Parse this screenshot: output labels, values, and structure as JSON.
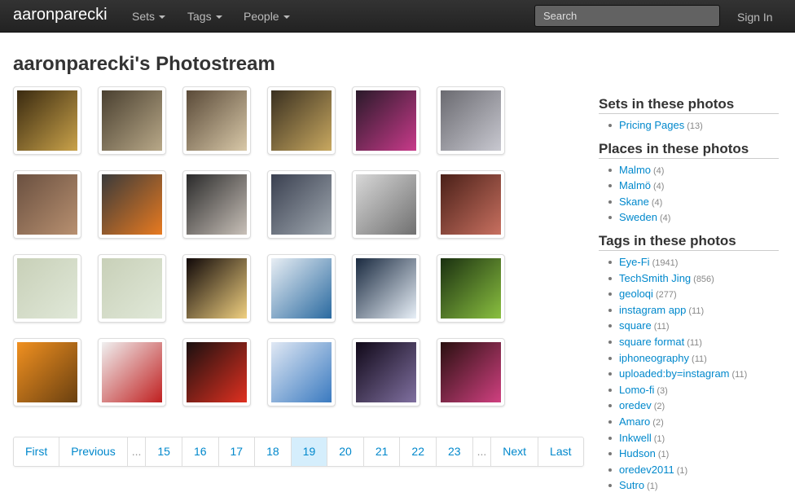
{
  "navbar": {
    "brand": "aaronparecki",
    "items": [
      {
        "label": "Sets"
      },
      {
        "label": "Tags"
      },
      {
        "label": "People"
      }
    ],
    "search_placeholder": "Search",
    "signin": "Sign In"
  },
  "page_title": "aaronparecki's Photostream",
  "thumbnails": [
    {
      "subject": "chandelier"
    },
    {
      "subject": "dining hall"
    },
    {
      "subject": "banquet table"
    },
    {
      "subject": "ballroom crowd"
    },
    {
      "subject": "pink menu"
    },
    {
      "subject": "street"
    },
    {
      "subject": "person in hallway"
    },
    {
      "subject": "orange sign"
    },
    {
      "subject": "notebook"
    },
    {
      "subject": "laptop"
    },
    {
      "subject": "comic sketch"
    },
    {
      "subject": "person at table"
    },
    {
      "subject": "map"
    },
    {
      "subject": "map"
    },
    {
      "subject": "stage lights"
    },
    {
      "subject": "pricing page"
    },
    {
      "subject": "pricing page"
    },
    {
      "subject": "green stage"
    },
    {
      "subject": "orange document"
    },
    {
      "subject": "newspaper page"
    },
    {
      "subject": "red card"
    },
    {
      "subject": "pricing page"
    },
    {
      "subject": "dark room"
    },
    {
      "subject": "pink menu"
    }
  ],
  "pagination": [
    "First",
    "Previous",
    "...",
    "15",
    "16",
    "17",
    "18",
    "19",
    "20",
    "21",
    "22",
    "23",
    "...",
    "Next",
    "Last"
  ],
  "pagination_active": "19",
  "sidebar": {
    "sets": {
      "title": "Sets in these photos",
      "items": [
        {
          "label": "Pricing Pages",
          "count": "(13)"
        }
      ]
    },
    "places": {
      "title": "Places in these photos",
      "items": [
        {
          "label": "Malmo",
          "count": "(4)"
        },
        {
          "label": "Malmö",
          "count": "(4)"
        },
        {
          "label": "Skane",
          "count": "(4)"
        },
        {
          "label": "Sweden",
          "count": "(4)"
        }
      ]
    },
    "tags": {
      "title": "Tags in these photos",
      "items": [
        {
          "label": "Eye-Fi",
          "count": "(1941)"
        },
        {
          "label": "TechSmith Jing",
          "count": "(856)"
        },
        {
          "label": "geoloqi",
          "count": "(277)"
        },
        {
          "label": "instagram app",
          "count": "(11)"
        },
        {
          "label": "square",
          "count": "(11)"
        },
        {
          "label": "square format",
          "count": "(11)"
        },
        {
          "label": "iphoneography",
          "count": "(11)"
        },
        {
          "label": "uploaded:by=instagram",
          "count": "(11)"
        },
        {
          "label": "Lomo-fi",
          "count": "(3)"
        },
        {
          "label": "oredev",
          "count": "(2)"
        },
        {
          "label": "Amaro",
          "count": "(2)"
        },
        {
          "label": "Inkwell",
          "count": "(1)"
        },
        {
          "label": "Hudson",
          "count": "(1)"
        },
        {
          "label": "oredev2011",
          "count": "(1)"
        },
        {
          "label": "Sutro",
          "count": "(1)"
        }
      ]
    }
  },
  "colors": {
    "link": "#0088cc",
    "navbar": "#222222",
    "active_page": "#d5eefc"
  }
}
